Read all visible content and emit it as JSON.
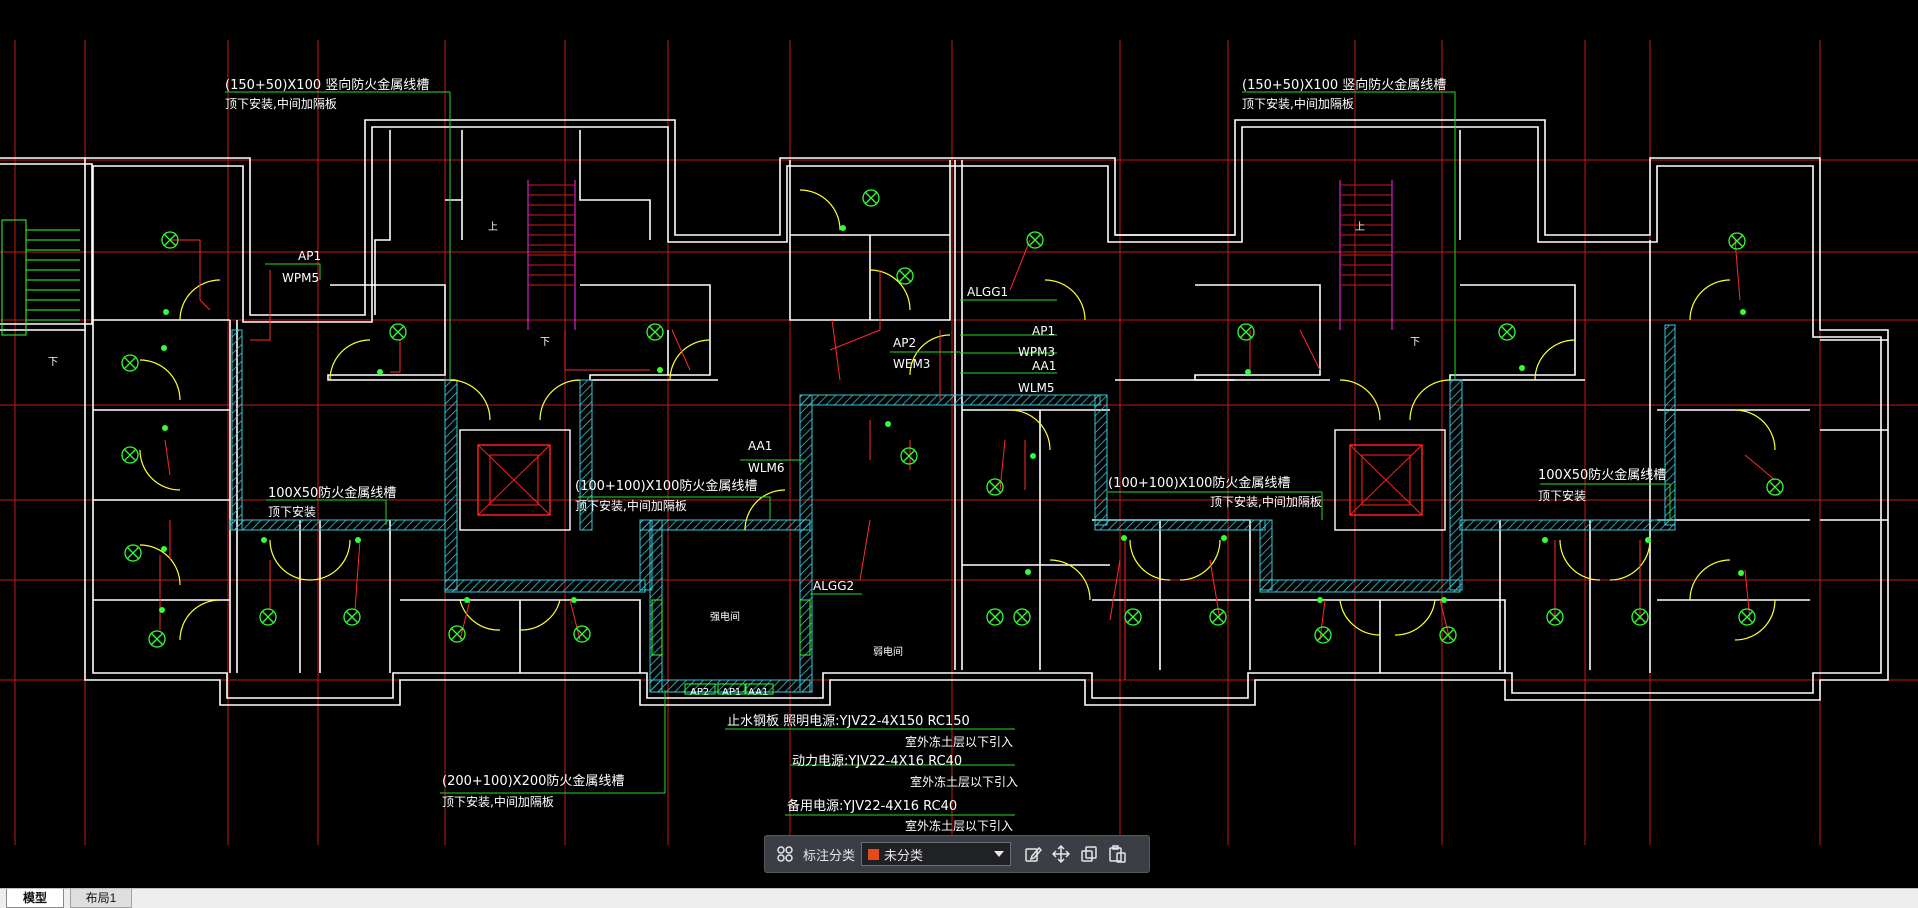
{
  "drawing": {
    "annotations": {
      "tray_top_left": "(150+50)X100 竖向防火金属线槽",
      "tray_top_left_note": "顶下安装,中间加隔板",
      "tray_top_right": "(150+50)X100 竖向防火金属线槽",
      "tray_top_right_note": "顶下安装,中间加隔板",
      "tray_mid_left": "100X50防火金属线槽",
      "tray_mid_left_note": "顶下安装",
      "tray_mid_center": "(100+100)X100防火金属线槽",
      "tray_mid_center_note": "顶下安装,中间加隔板",
      "tray_mid_right": "(100+100)X100防火金属线槽",
      "tray_mid_right_note": "顶下安装,中间加隔板",
      "tray_far_right": "100X50防火金属线槽",
      "tray_far_right_note": "顶下安装",
      "tray_bottom": "(200+100)X200防火金属线槽",
      "tray_bottom_note": "顶下安装,中间加隔板",
      "cable_1": "止水钢板 照明电源:YJV22-4X150  RC150",
      "cable_1_note": "室外冻土层以下引入",
      "cable_2": "动力电源:YJV22-4X16  RC40",
      "cable_2_note": "室外冻土层以下引入",
      "cable_3": "备用电源:YJV22-4X16  RC40",
      "cable_3_note": "室外冻土层以下引入"
    },
    "labels": {
      "ap1_left": "AP1",
      "wpm5": "WPM5",
      "aa1_left": "AA1",
      "wlm6": "WLM6",
      "ap2": "AP2",
      "wem3": "WEM3",
      "algg1": "ALGG1",
      "ap1_right": "AP1",
      "wpm3": "WPM3",
      "aa1_right": "AA1",
      "wlm5": "WLM5",
      "algg2": "ALGG2",
      "room_1": "强电间",
      "room_2": "弱电间",
      "down_1": "下",
      "down_2": "下",
      "down_3": "下",
      "up_1": "上",
      "up_2": "上",
      "panel_ap2": "AP2",
      "panel_ap1": "AP1",
      "panel_aa1": "AA1"
    }
  },
  "toolbar": {
    "layout_icon": "grid-icon",
    "label": "标注分类",
    "category_value": "未分类",
    "category_color": "#e64a19",
    "edit_icon": "edit-icon",
    "move_icon": "move-icon",
    "copy_icon": "copy-icon",
    "paste_icon": "paste-icon"
  },
  "tabs": {
    "model": "模型",
    "layout1": "布局1"
  },
  "colors": {
    "background": "#000000",
    "wall": "#ffffff",
    "axis": "#ff2020",
    "wire": "#ff2a2a",
    "fixture": "#33ff33",
    "leader": "#22dd22",
    "shaft_hatch": "#39c9d9",
    "stair": "#ff2aff",
    "door": "#ffff33"
  }
}
